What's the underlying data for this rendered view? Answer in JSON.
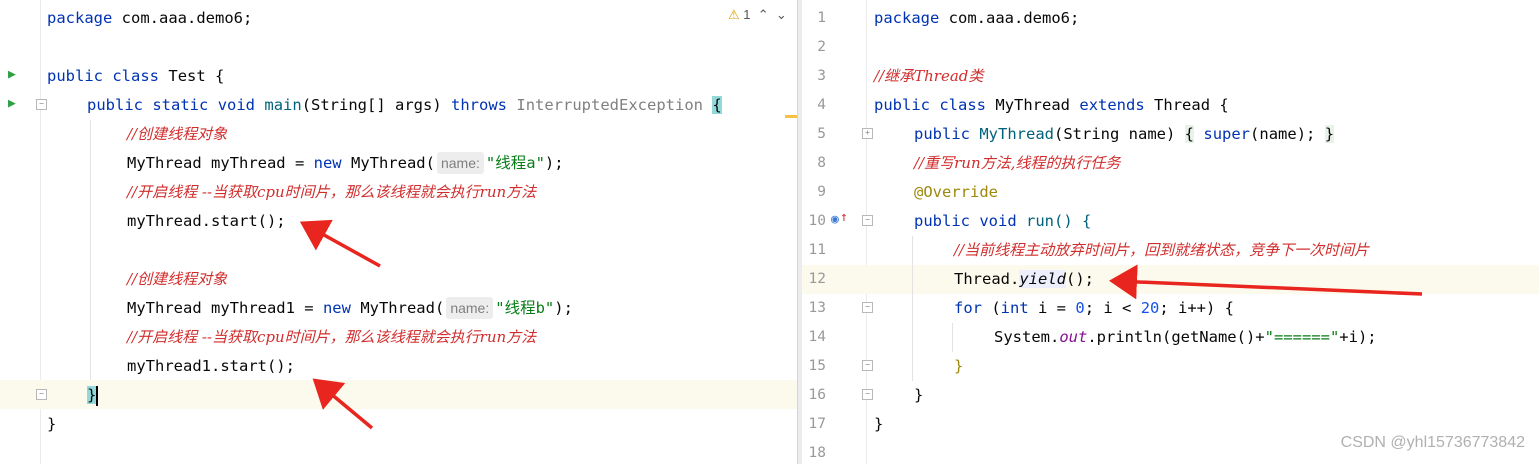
{
  "left": {
    "warning_count": "1",
    "lines": [
      {
        "package_kw": "package",
        "package_name": "com.aaa.demo6;"
      },
      {},
      {
        "kw1": "public",
        "kw2": "class",
        "name": "Test",
        "brace": "{"
      },
      {
        "kw1": "public",
        "kw2": "static",
        "kw3": "void",
        "name": "main",
        "params": "(String[] args)",
        "throws_kw": "throws",
        "exc": "InterruptedException",
        "brace": "{"
      },
      {
        "comment": "//创建线程对象"
      },
      {
        "type": "MyThread myThread = ",
        "new_kw": "new",
        "ctor": "MyThread(",
        "hint": "name:",
        "str": "\"线程a\"",
        "tail": ");"
      },
      {
        "comment": "//开启线程 --当获取cpu时间片，那么该线程就会执行run方法"
      },
      {
        "code": "myThread.start();"
      },
      {},
      {
        "comment": "//创建线程对象"
      },
      {
        "type": "MyThread myThread1 = ",
        "new_kw": "new",
        "ctor": "MyThread(",
        "hint": "name:",
        "str": "\"线程b\"",
        "tail": ");"
      },
      {
        "comment": "//开启线程 --当获取cpu时间片，那么该线程就会执行run方法"
      },
      {
        "code": "myThread1.start();"
      },
      {
        "code": "}"
      },
      {
        "code": "}"
      }
    ]
  },
  "right": {
    "line_numbers": [
      "1",
      "2",
      "3",
      "4",
      "5",
      "8",
      "9",
      "10",
      "11",
      "12",
      "13",
      "14",
      "15",
      "16",
      "17",
      "18"
    ],
    "package_kw": "package",
    "package_name": "com.aaa.demo6;",
    "class_comment": "//继承Thread类",
    "class_decl": {
      "kw1": "public",
      "kw2": "class",
      "name": "MyThread",
      "ext_kw": "extends",
      "parent": "Thread",
      "brace": "{"
    },
    "ctor": {
      "kw": "public",
      "name": "MyThread",
      "params": "(String name)",
      "body_open": "{",
      "super_kw": "super",
      "body_mid": "(name);",
      "body_close": "}"
    },
    "override_comment": "//重写run方法,线程的执行任务",
    "annotation": "@Override",
    "run_decl": {
      "kw1": "public",
      "kw2": "void",
      "name": "run() {"
    },
    "yield_comment": "//当前线程主动放弃时间片，回到就绪状态，竞争下一次时间片",
    "yield_call": {
      "prefix": "Thread.",
      "method": "yield",
      "suffix": "();"
    },
    "for_loop": {
      "kw": "for",
      "open": " (",
      "int_kw": "int",
      "rest1": " i = ",
      "zero": "0",
      "rest2": "; i < ",
      "twenty": "20",
      "rest3": "; i++) {"
    },
    "println": {
      "prefix": "System.",
      "out": "out",
      "mid": ".println(getName()+",
      "str": "\"======\"",
      "tail": "+i);"
    },
    "close_for": "}",
    "close_run": "}",
    "close_class": "}"
  },
  "watermark": "CSDN @yhl15736773842",
  "colors": {
    "keyword": "#0033b3",
    "comment": "#d12d2d",
    "string": "#067d17",
    "number": "#1750eb",
    "annotation": "#9e880d",
    "arrow": "#e8251e"
  }
}
